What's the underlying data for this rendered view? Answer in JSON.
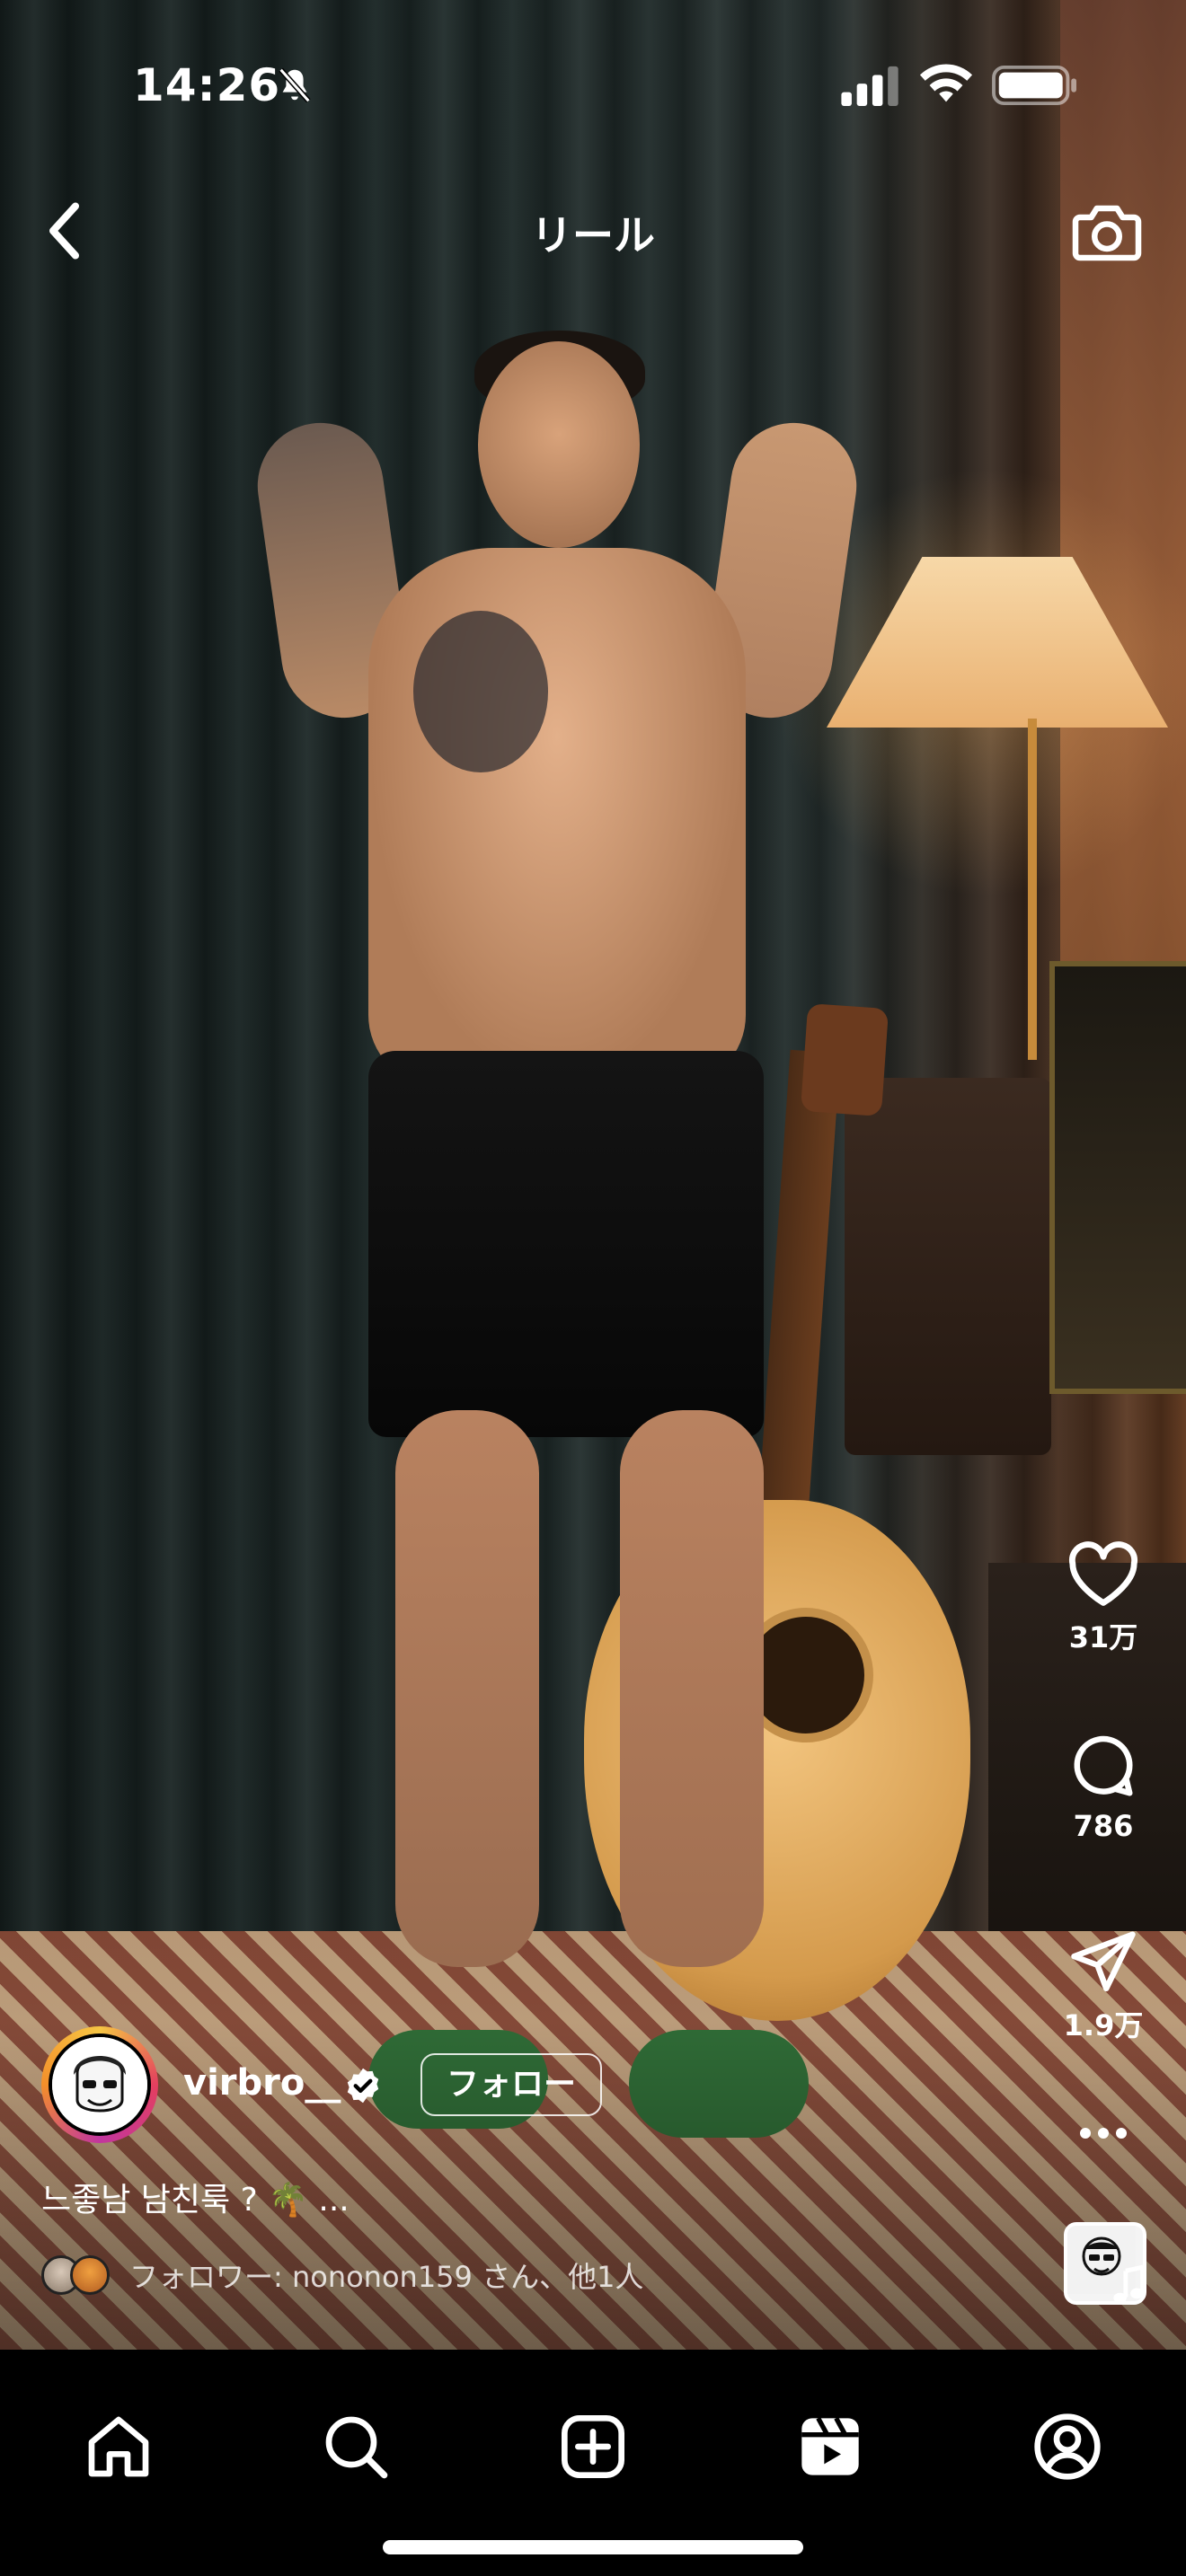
{
  "status_bar": {
    "time": "14:26",
    "icons": [
      "bell-off-icon",
      "cellular-signal-icon",
      "wifi-icon",
      "battery-icon"
    ]
  },
  "header": {
    "title": "リール",
    "left_icon": "back-chevron-icon",
    "right_icon": "camera-icon"
  },
  "actions": {
    "like_count": "31万",
    "comment_count": "786",
    "share_count": "1.9万",
    "icons": [
      "heart-icon",
      "comment-icon",
      "send-icon",
      "more-icon",
      "audio-thumbnail-icon"
    ]
  },
  "creator": {
    "username": "virbro__",
    "verified": true,
    "follow_label": "フォロー",
    "caption": "느좋남 남친룩 ? 🌴 ...",
    "followers_text": "フォロワー: nononon159 さん、他1人"
  },
  "nav": {
    "items": [
      "home-icon",
      "search-icon",
      "create-icon",
      "reels-icon",
      "profile-icon"
    ]
  },
  "colors": {
    "accent_ring": "#e33f5f",
    "slipper": "#2f6b36",
    "nav_bg": "#000000"
  }
}
